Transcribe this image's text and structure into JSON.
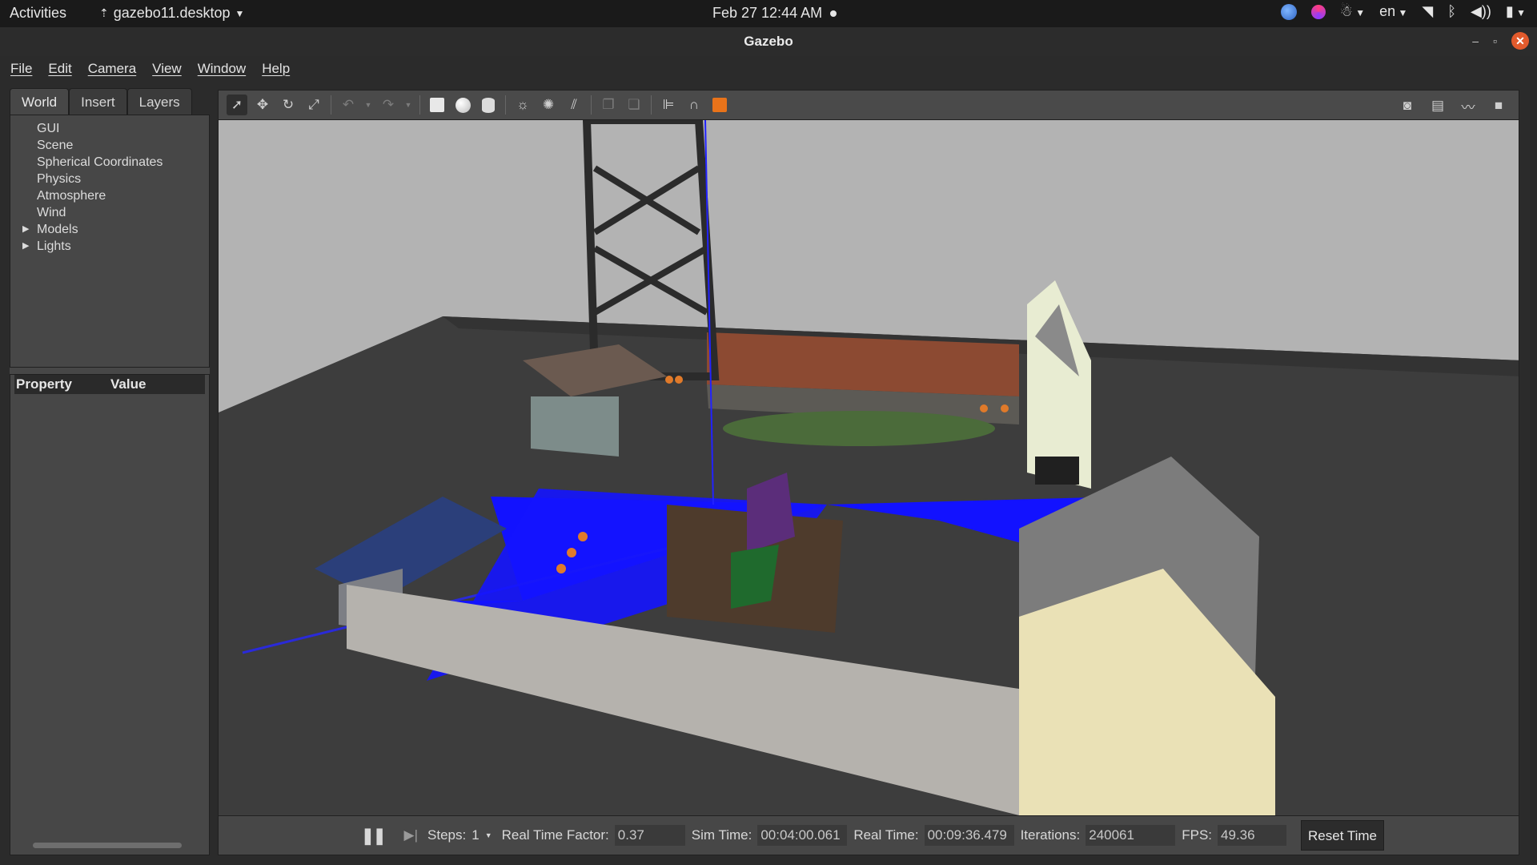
{
  "topbar": {
    "activities": "Activities",
    "app_name": "gazebo11.desktop",
    "datetime": "Feb 27  12:44 AM",
    "language": "en"
  },
  "window": {
    "title": "Gazebo"
  },
  "menu": {
    "items": [
      "File",
      "Edit",
      "Camera",
      "View",
      "Window",
      "Help"
    ]
  },
  "left_panel": {
    "tabs": [
      "World",
      "Insert",
      "Layers"
    ],
    "active_tab": "World",
    "tree_items": [
      "GUI",
      "Scene",
      "Spherical Coordinates",
      "Physics",
      "Atmosphere",
      "Wind",
      "Models",
      "Lights"
    ],
    "property_header": "Property",
    "value_header": "Value"
  },
  "toolbar": {
    "tools": [
      "select-icon",
      "translate-icon",
      "rotate-icon",
      "scale-icon",
      "undo-icon",
      "redo-icon",
      "box-icon",
      "sphere-icon",
      "cylinder-icon",
      "point-light-icon",
      "spot-light-icon",
      "directional-light-icon",
      "copy-icon",
      "paste-icon",
      "align-icon",
      "snap-icon",
      "view-angle-icon"
    ],
    "right_tools": [
      "screenshot-icon",
      "log-icon",
      "plot-icon",
      "record-icon"
    ]
  },
  "statusbar": {
    "steps_label": "Steps:",
    "steps_value": "1",
    "rtf_label": "Real Time Factor:",
    "rtf_value": "0.37",
    "sim_time_label": "Sim Time:",
    "sim_time_value": "00:04:00.061",
    "real_time_label": "Real Time:",
    "real_time_value": "00:09:36.479",
    "iterations_label": "Iterations:",
    "iterations_value": "240061",
    "fps_label": "FPS:",
    "fps_value": "49.36",
    "reset_label": "Reset Time"
  },
  "colors": {
    "accent": "#e25a2c",
    "laser": "#1010ff",
    "ground": "#3c3c3c",
    "sky": "#b3b3b3"
  }
}
